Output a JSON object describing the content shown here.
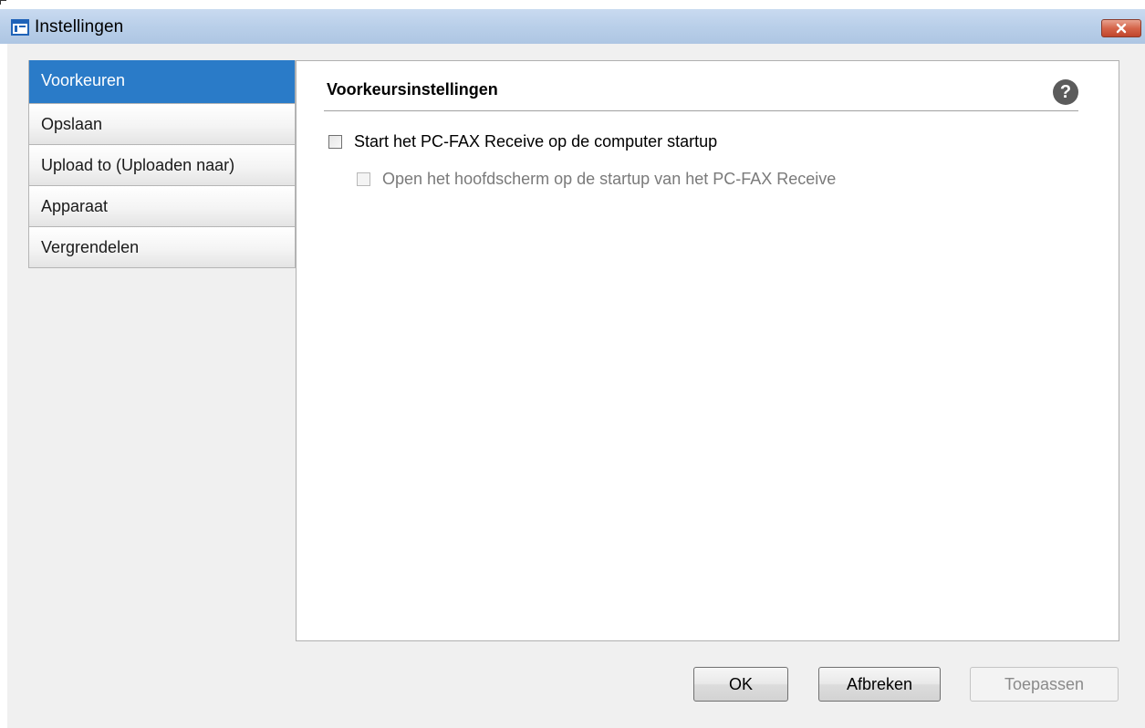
{
  "window": {
    "title": "Instellingen"
  },
  "sidebar": {
    "items": [
      {
        "label": "Voorkeuren",
        "active": true
      },
      {
        "label": "Opslaan",
        "active": false
      },
      {
        "label": "Upload to (Uploaden naar)",
        "active": false
      },
      {
        "label": "Apparaat",
        "active": false
      },
      {
        "label": "Vergrendelen",
        "active": false
      }
    ]
  },
  "panel": {
    "title": "Voorkeursinstellingen",
    "help_symbol": "?",
    "options": [
      {
        "label": "Start het PC-FAX Receive op de computer startup",
        "checked": false,
        "enabled": true
      },
      {
        "label": "Open het hoofdscherm op de startup van het PC-FAX Receive",
        "checked": false,
        "enabled": false
      }
    ]
  },
  "buttons": {
    "ok": "OK",
    "cancel": "Afbreken",
    "apply": "Toepassen",
    "apply_enabled": false
  },
  "colors": {
    "accent": "#2a7bc8",
    "close_button": "#d5654a",
    "titlebar": "#b9cfe9"
  }
}
